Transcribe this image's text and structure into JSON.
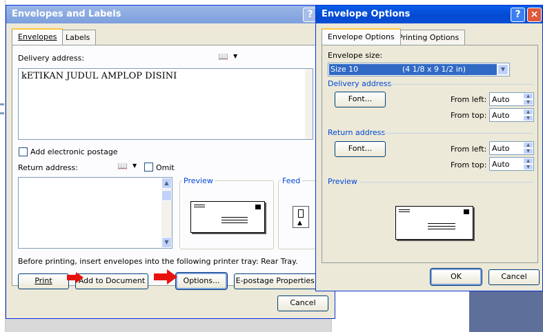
{
  "envelopes_dialog": {
    "title": "Envelopes and Labels",
    "help_glyph": "?",
    "tabs": [
      {
        "label": "Envelopes"
      },
      {
        "label": "Labels"
      }
    ],
    "delivery_label": "Delivery address:",
    "delivery_text": "kETIKAN JUDUL AMPLOP DISINI",
    "add_postage_label": "Add electronic postage",
    "return_label": "Return address:",
    "omit_label": "Omit",
    "preview_label": "Preview",
    "feed_label": "Feed",
    "tray_note": "Before printing, insert envelopes into the following printer tray: Rear Tray.",
    "buttons": {
      "print": "Print",
      "add_to_document": "Add to Document",
      "options": "Options...",
      "epostage": "E-postage Properties...",
      "cancel": "Cancel"
    }
  },
  "options_dialog": {
    "title": "Envelope Options",
    "help_glyph": "?",
    "close_glyph": "×",
    "tabs": [
      {
        "label": "Envelope Options"
      },
      {
        "label": "Printing Options"
      }
    ],
    "size_label": "Envelope size:",
    "size_value": "Size 10",
    "size_dims": "(4 1/8 x 9 1/2 in)",
    "delivery_section": "Delivery address",
    "return_section": "Return address",
    "preview_section": "Preview",
    "font_button": "Font...",
    "from_left": "From left:",
    "from_top": "From top:",
    "auto": "Auto",
    "ok": "OK",
    "cancel": "Cancel"
  },
  "icons": {
    "address_book": "address-book-icon",
    "dropdown": "chevron-down-icon",
    "red_arrow": "red-arrow-icon"
  },
  "colors": {
    "xp_blue_title": "#0349d1",
    "inactive_title": "#7c9fdc",
    "dialog_face": "#ece9d8",
    "annotation_red": "#e8120c",
    "selection": "#316ac5"
  }
}
